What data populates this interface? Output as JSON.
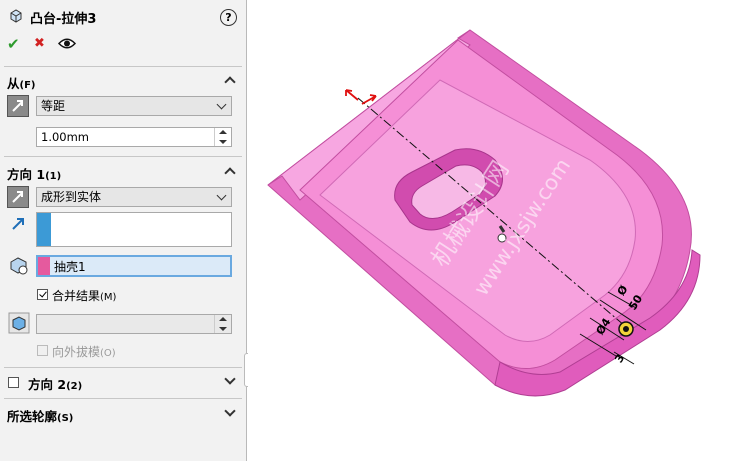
{
  "feature": {
    "title": "凸台-拉伸3",
    "help": "?"
  },
  "actions": {
    "ok": "✔",
    "cancel": "✖",
    "preview": "eye-icon"
  },
  "from": {
    "title": "从",
    "hotkey": "(F)",
    "mode": "等距",
    "offset_value": "1.00mm"
  },
  "direction1": {
    "title": "方向 1",
    "suffix": "(1)",
    "end_condition": "成形到实体",
    "selected_body": "抽壳1",
    "merge_label": "合并结果",
    "merge_hotkey": "(M)",
    "merge_checked": true,
    "draft_label": "向外拔模",
    "draft_hotkey": "(O)"
  },
  "direction2": {
    "title": "方向 2",
    "suffix": "(2)",
    "checked": false
  },
  "contours": {
    "title": "所选轮廓",
    "hotkey": "(S)"
  },
  "viewport": {
    "watermark1": "机械设计网",
    "watermark2": "www.jxsjw.com",
    "dim_dia1": "Ø4",
    "dim_dia2": "Ø",
    "dim_50": "50",
    "dim_3": "3",
    "part_color": "#f58fd6"
  },
  "colors": {
    "accent": "#3c9ad6",
    "ok": "#2e9b2e",
    "cancel": "#d22222",
    "selection": "#e55a9e"
  }
}
